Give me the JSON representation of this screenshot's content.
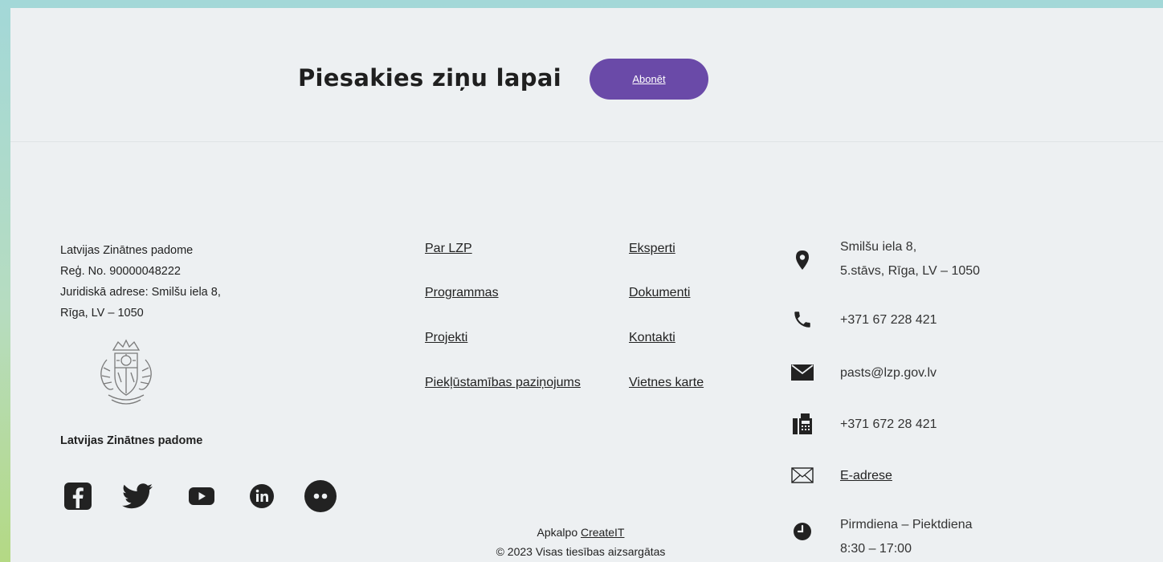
{
  "newsletter": {
    "title": "Piesakies ziņu lapai",
    "subscribe_label": "Abonēt"
  },
  "organization": {
    "lines": [
      "Latvijas Zinātnes padome",
      "Reģ. No. 90000048222",
      "Juridiskā adrese: Smilšu iela 8,",
      "Rīga, LV – 1050"
    ],
    "name": "Latvijas Zinātnes padome"
  },
  "social": [
    {
      "icon": "facebook-icon"
    },
    {
      "icon": "twitter-icon"
    },
    {
      "icon": "youtube-icon"
    },
    {
      "icon": "linkedin-icon"
    },
    {
      "icon": "flickr-icon"
    }
  ],
  "nav_links": [
    {
      "label": "Par LZP"
    },
    {
      "label": "Programmas"
    },
    {
      "label": "Projekti"
    },
    {
      "label": "Piekļūstamības paziņojums"
    },
    {
      "label": "Eksperti"
    },
    {
      "label": "Dokumenti"
    },
    {
      "label": "Kontakti"
    },
    {
      "label": "Vietnes karte"
    }
  ],
  "contacts": {
    "address_line1": "Smilšu iela 8,",
    "address_line2": "5.stāvs, Rīga, LV – 1050",
    "phone": " +371 67 228 421",
    "email": "pasts@lzp.gov.lv",
    "fax": "+371 672 28 421",
    "e_address": "E-adrese",
    "hours_days": "Pirmdiena – Piektdiena",
    "hours_time": "8:30 – 17:00"
  },
  "footer": {
    "serviced_by": "Apkalpo ",
    "serviced_by_link": "CreateIT",
    "copyright": "© 2023 Visas tiesības aizsargātas"
  },
  "colors": {
    "accent": "#6a4aa8",
    "panel": "#edf0f2",
    "icon": "#222222"
  }
}
